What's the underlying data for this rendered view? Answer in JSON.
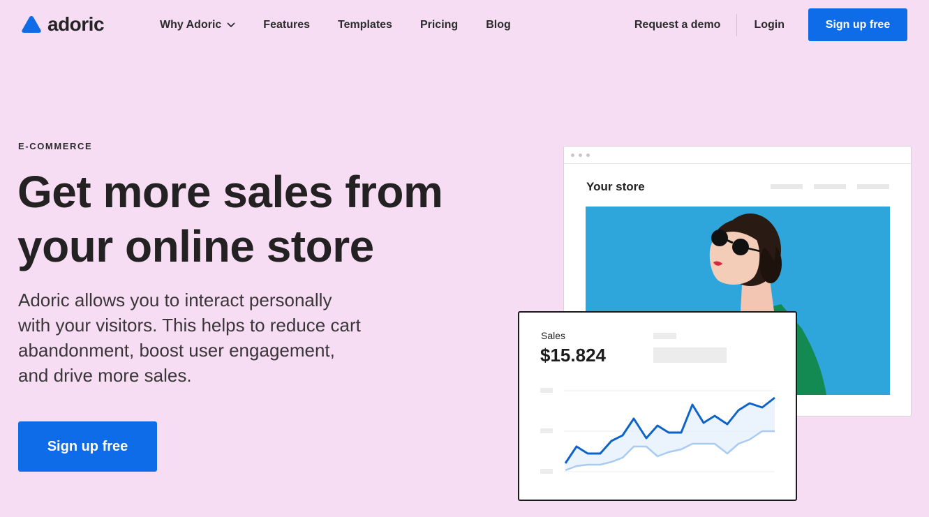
{
  "brand": {
    "name": "adoric",
    "accent": "#0e6ce8",
    "background": "#f6ddf4"
  },
  "nav": {
    "links": [
      {
        "label": "Why Adoric",
        "has_dropdown": true
      },
      {
        "label": "Features"
      },
      {
        "label": "Templates"
      },
      {
        "label": "Pricing"
      },
      {
        "label": "Blog"
      }
    ],
    "request_demo": "Request a demo",
    "login": "Login",
    "signup": "Sign up free"
  },
  "hero": {
    "eyebrow": "E-COMMERCE",
    "headline": "Get more sales from your online store",
    "description": "Adoric allows you to interact personally with your visitors. This helps to reduce cart abandonment, boost user engagement, and drive more sales.",
    "cta": "Sign up free"
  },
  "store_mockup": {
    "title": "Your store",
    "photo_color": "#2ea6dc"
  },
  "sales_card": {
    "label": "Sales",
    "value": "$15.824",
    "series_colors": [
      "#0d63c9",
      "#a9cbf2"
    ]
  }
}
